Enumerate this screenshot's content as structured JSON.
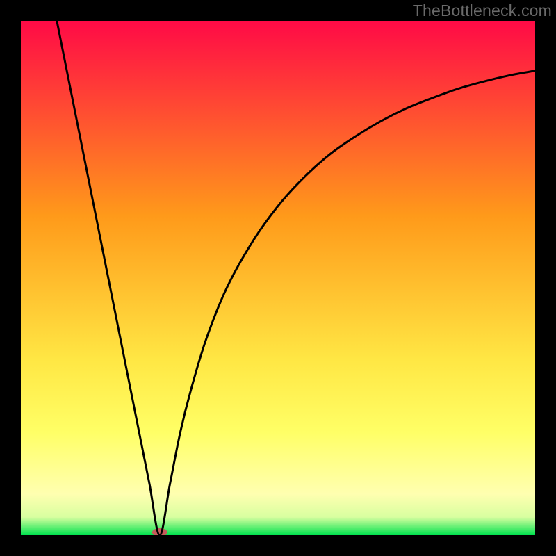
{
  "watermark": "TheBottleneck.com",
  "chart_data": {
    "type": "line",
    "title": "",
    "xlabel": "",
    "ylabel": "",
    "xlim": [
      0,
      100
    ],
    "ylim": [
      0,
      100
    ],
    "grid": false,
    "legend": false,
    "background_gradient_top": "#ff0a46",
    "background_gradient_mid_upper": "#ff9a1a",
    "background_gradient_mid_lower": "#ffff66",
    "background_gradient_bottom": "#00e24e",
    "marker": {
      "x": 27,
      "y": 0,
      "color": "#c45a5a"
    },
    "series": [
      {
        "name": "curve",
        "type": "line",
        "color": "#000000",
        "x": [
          7,
          9,
          11,
          13,
          15,
          17,
          19,
          21,
          23,
          25,
          27,
          29,
          31,
          33,
          36,
          40,
          45,
          50,
          55,
          60,
          65,
          70,
          75,
          80,
          85,
          90,
          95,
          100
        ],
        "y": [
          100,
          90,
          80,
          70,
          60,
          50,
          40,
          30,
          20,
          10,
          0,
          10,
          20,
          28,
          38,
          48,
          57,
          64,
          69.5,
          74,
          77.5,
          80.5,
          83,
          85,
          86.8,
          88.2,
          89.4,
          90.3
        ]
      }
    ]
  }
}
